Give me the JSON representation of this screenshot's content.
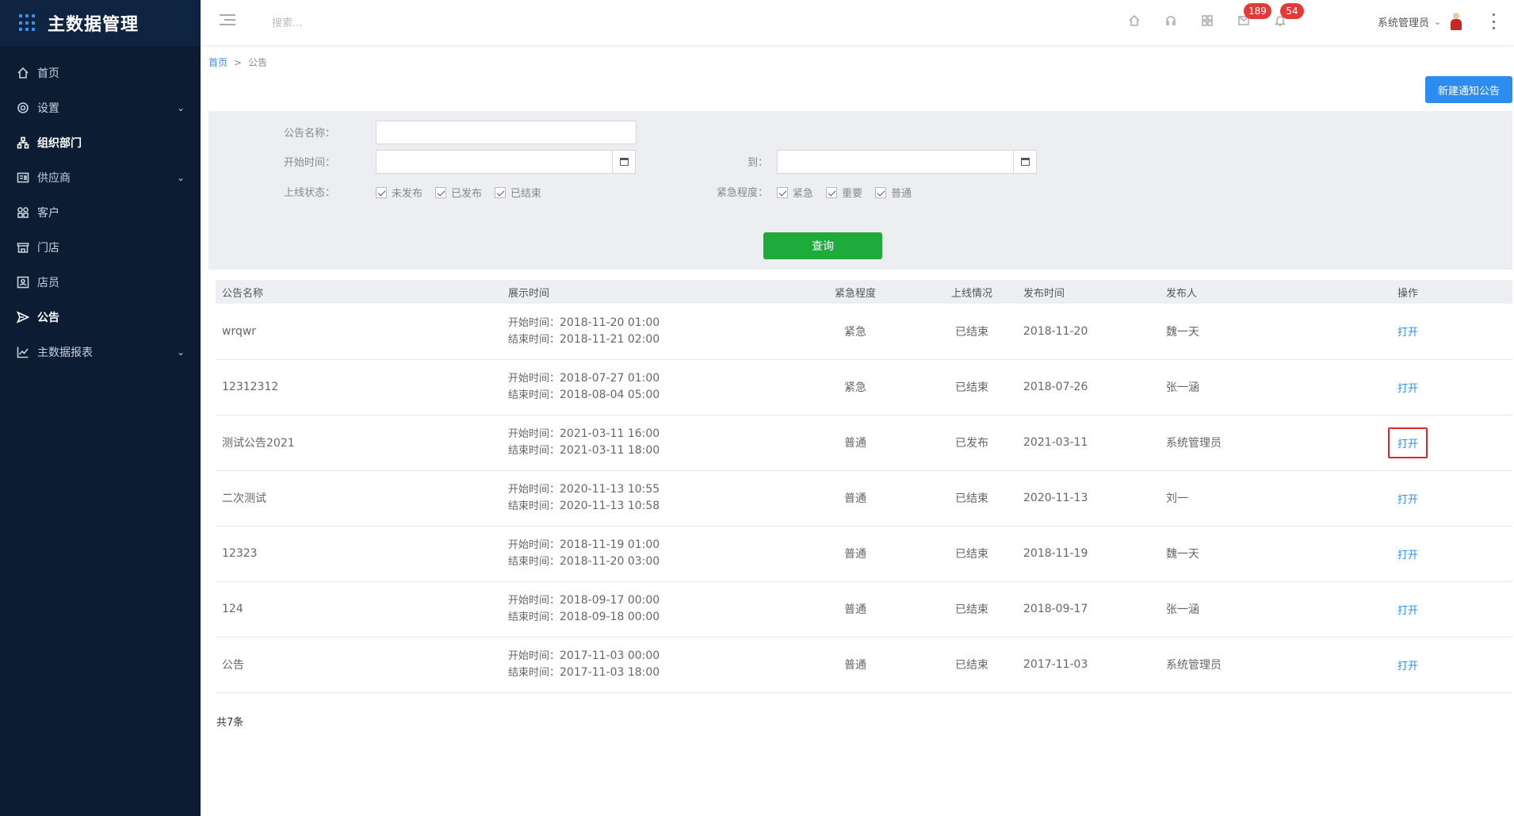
{
  "brand": {
    "title": "主数据管理"
  },
  "sidebar": {
    "items": [
      {
        "label": "首页",
        "icon": "home-icon",
        "has_children": false,
        "active": false
      },
      {
        "label": "设置",
        "icon": "gear-icon",
        "has_children": true,
        "active": false
      },
      {
        "label": "组织部门",
        "icon": "org-icon",
        "has_children": false,
        "active": false
      },
      {
        "label": "供应商",
        "icon": "supplier-icon",
        "has_children": true,
        "active": false
      },
      {
        "label": "客户",
        "icon": "customer-icon",
        "has_children": false,
        "active": false
      },
      {
        "label": "门店",
        "icon": "store-icon",
        "has_children": false,
        "active": false
      },
      {
        "label": "店员",
        "icon": "clerk-icon",
        "has_children": false,
        "active": false
      },
      {
        "label": "公告",
        "icon": "send-icon",
        "has_children": false,
        "active": true
      },
      {
        "label": "主数据报表",
        "icon": "chart-icon",
        "has_children": true,
        "active": false
      }
    ]
  },
  "header": {
    "search_placeholder": "搜索...",
    "badges": {
      "messages": "189",
      "notifications": "54"
    },
    "user_name": "系统管理员"
  },
  "breadcrumb": {
    "home": "首页",
    "separator": ">",
    "current": "公告"
  },
  "actions": {
    "new_button": "新建通知公告"
  },
  "filter": {
    "name_label": "公告名称：",
    "start_label": "开始时间：",
    "to_label": "到：",
    "status_label": "上线状态：",
    "status_options": [
      "未发布",
      "已发布",
      "已结束"
    ],
    "urgency_label": "紧急程度：",
    "urgency_options": [
      "紧急",
      "重要",
      "普通"
    ],
    "query_button": "查询"
  },
  "table": {
    "headers": [
      "公告名称",
      "展示时间",
      "紧急程度",
      "上线情况",
      "发布时间",
      "发布人",
      "操作"
    ],
    "start_prefix": "开始时间：",
    "end_prefix": "结束时间：",
    "rows": [
      {
        "name": "wrqwr",
        "start": "2018-11-20 01:00",
        "end": "2018-11-21 02:00",
        "urgency": "紧急",
        "status": "已结束",
        "published": "2018-11-20",
        "publisher": "魏一天",
        "action": "打开"
      },
      {
        "name": "12312312",
        "start": "2018-07-27 01:00",
        "end": "2018-08-04 05:00",
        "urgency": "紧急",
        "status": "已结束",
        "published": "2018-07-26",
        "publisher": "张一涵",
        "action": "打开"
      },
      {
        "name": "测试公告2021",
        "start": "2021-03-11 16:00",
        "end": "2021-03-11 18:00",
        "urgency": "普通",
        "status": "已发布",
        "published": "2021-03-11",
        "publisher": "系统管理员",
        "action": "打开",
        "highlighted": true
      },
      {
        "name": "二次测试",
        "start": "2020-11-13 10:55",
        "end": "2020-11-13 10:58",
        "urgency": "普通",
        "status": "已结束",
        "published": "2020-11-13",
        "publisher": "刘一",
        "action": "打开"
      },
      {
        "name": "12323",
        "start": "2018-11-19 01:00",
        "end": "2018-11-20 03:00",
        "urgency": "普通",
        "status": "已结束",
        "published": "2018-11-19",
        "publisher": "魏一天",
        "action": "打开"
      },
      {
        "name": "124",
        "start": "2018-09-17 00:00",
        "end": "2018-09-18 00:00",
        "urgency": "普通",
        "status": "已结束",
        "published": "2018-09-17",
        "publisher": "张一涵",
        "action": "打开"
      },
      {
        "name": "公告",
        "start": "2017-11-03 00:00",
        "end": "2017-11-03 18:00",
        "urgency": "普通",
        "status": "已结束",
        "published": "2017-11-03",
        "publisher": "系统管理员",
        "action": "打开"
      }
    ]
  },
  "footer": {
    "total": "共7条"
  },
  "colors": {
    "sidebar_bg": "#0b1c33",
    "primary": "#2d8cf0",
    "query": "#1faa3c",
    "badge": "#e53935",
    "highlight_border": "#e0262b"
  }
}
